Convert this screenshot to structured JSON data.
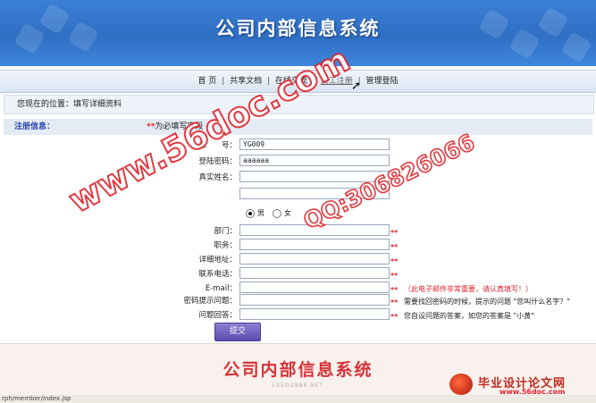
{
  "header": {
    "title": "公司内部信息系统"
  },
  "nav": {
    "items": [
      {
        "label": "首 页"
      },
      {
        "label": "共享文档"
      },
      {
        "label": "在线交流"
      },
      {
        "label": "员工注册"
      },
      {
        "label": "管理登陆"
      }
    ],
    "separator": "|"
  },
  "breadcrumb": {
    "text": "您现在的位置：填写详细资料"
  },
  "form": {
    "section_title": "注册信息：",
    "required_marker": "**",
    "required_note": "为必填写字段",
    "fields": {
      "employee_id": {
        "label": "工　　号：",
        "value": "YG009"
      },
      "password": {
        "label": "登陆密码：",
        "value": "aaaaaa"
      },
      "real_name": {
        "label": "真实姓名：",
        "value": ""
      },
      "gender": {
        "label": "",
        "options": [
          "男",
          "女"
        ],
        "selected": "男"
      },
      "department": {
        "label": "部门：",
        "value": ""
      },
      "position": {
        "label": "职务：",
        "value": ""
      },
      "address": {
        "label": "详细地址：",
        "value": ""
      },
      "phone": {
        "label": "联系电话：",
        "value": ""
      },
      "email": {
        "label": "E-mail：",
        "value": "",
        "hint": "（此电子邮件非常重要，请认真填写！）"
      },
      "question": {
        "label": "密码提示问题：",
        "value": "",
        "hint": "需要找回密码的时候，提示的问题 \"您叫什么名字？\""
      },
      "answer": {
        "label": "问题回答：",
        "value": "",
        "hint": "您自设问题的答案，如您的答案是 \"小黄\""
      }
    },
    "submit_label": "提交"
  },
  "footer": {
    "title": "公司内部信息系统",
    "sub": "LSSOU888.NET"
  },
  "status_bar": {
    "url": "rph/member/index.jsp"
  },
  "watermark": {
    "site": "www.56doc.com",
    "qq": "QQ:306826066"
  },
  "logo": {
    "text": "毕业设计论文网",
    "url": "www.56doc.com"
  },
  "colors": {
    "banner": "#2f6fc4",
    "accent_red": "#e0252d",
    "section_title": "#2a47a8",
    "submit": "#5a4db0"
  }
}
